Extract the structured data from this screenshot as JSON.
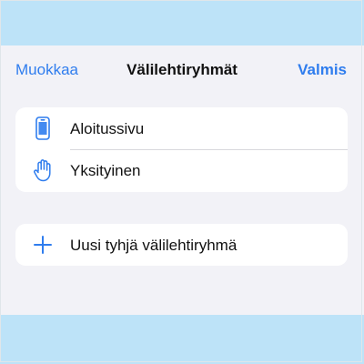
{
  "nav": {
    "left_label": "Muokkaa",
    "title": "Välilehtiryhmät",
    "right_label": "Valmis"
  },
  "groups": {
    "items": [
      {
        "label": "Aloitussivu",
        "icon": "phone-icon"
      },
      {
        "label": "Yksityinen",
        "icon": "hand-icon"
      }
    ]
  },
  "new_group": {
    "label": "Uusi tyhjä välilehtiryhmä",
    "icon": "plus-icon"
  },
  "colors": {
    "accent": "#2f7dee",
    "band": "#bde3f8",
    "background": "#f2f2f7"
  }
}
